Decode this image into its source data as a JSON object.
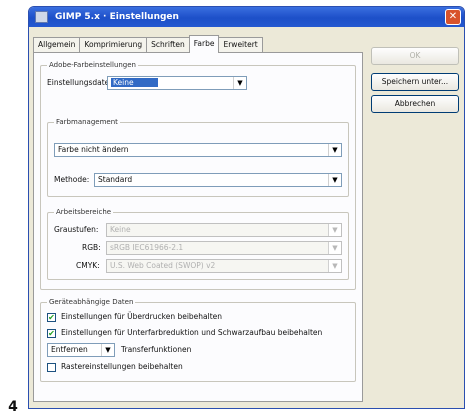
{
  "window": {
    "title": "GIMP 5.x · Einstellungen"
  },
  "tabs": [
    "Allgemein",
    "Komprimierung",
    "Schriften",
    "Farbe",
    "Erweitert"
  ],
  "active_tab": "Farbe",
  "adobe_group": {
    "title": "Adobe-Farbeinstellungen",
    "settings_file_label": "Einstellungsdatei:",
    "settings_file_value": "Keine"
  },
  "color_management": {
    "title": "Farbmanagement",
    "option_value": "Farbe nicht ändern",
    "method_label": "Methode:",
    "method_value": "Standard"
  },
  "working_spaces": {
    "title": "Arbeitsbereiche",
    "gray_label": "Graustufen:",
    "gray_value": "Keine",
    "rgb_label": "RGB:",
    "rgb_value": "sRGB IEC61966-2.1",
    "cmyk_label": "CMYK:",
    "cmyk_value": "U.S. Web Coated (SWOP) v2"
  },
  "device_group": {
    "title": "Geräteabhängige Daten",
    "overprint_label": "Einstellungen für Überdrucken beibehalten",
    "overprint_checked": true,
    "ucr_label": "Einstellungen für Unterfarbreduktion und Schwarzaufbau beibehalten",
    "ucr_checked": true,
    "transfer_value": "Entfernen",
    "transfer_label": "Transferfunktionen",
    "halftone_label": "Rastereinstellungen beibehalten",
    "halftone_checked": false
  },
  "buttons": {
    "ok": "OK",
    "save_as": "Speichern unter...",
    "cancel": "Abbrechen"
  },
  "figure_number": "4",
  "colors": {
    "titlebar": "#2458d0",
    "selection": "#316ac5",
    "dialog_bg": "#ece9d8"
  }
}
